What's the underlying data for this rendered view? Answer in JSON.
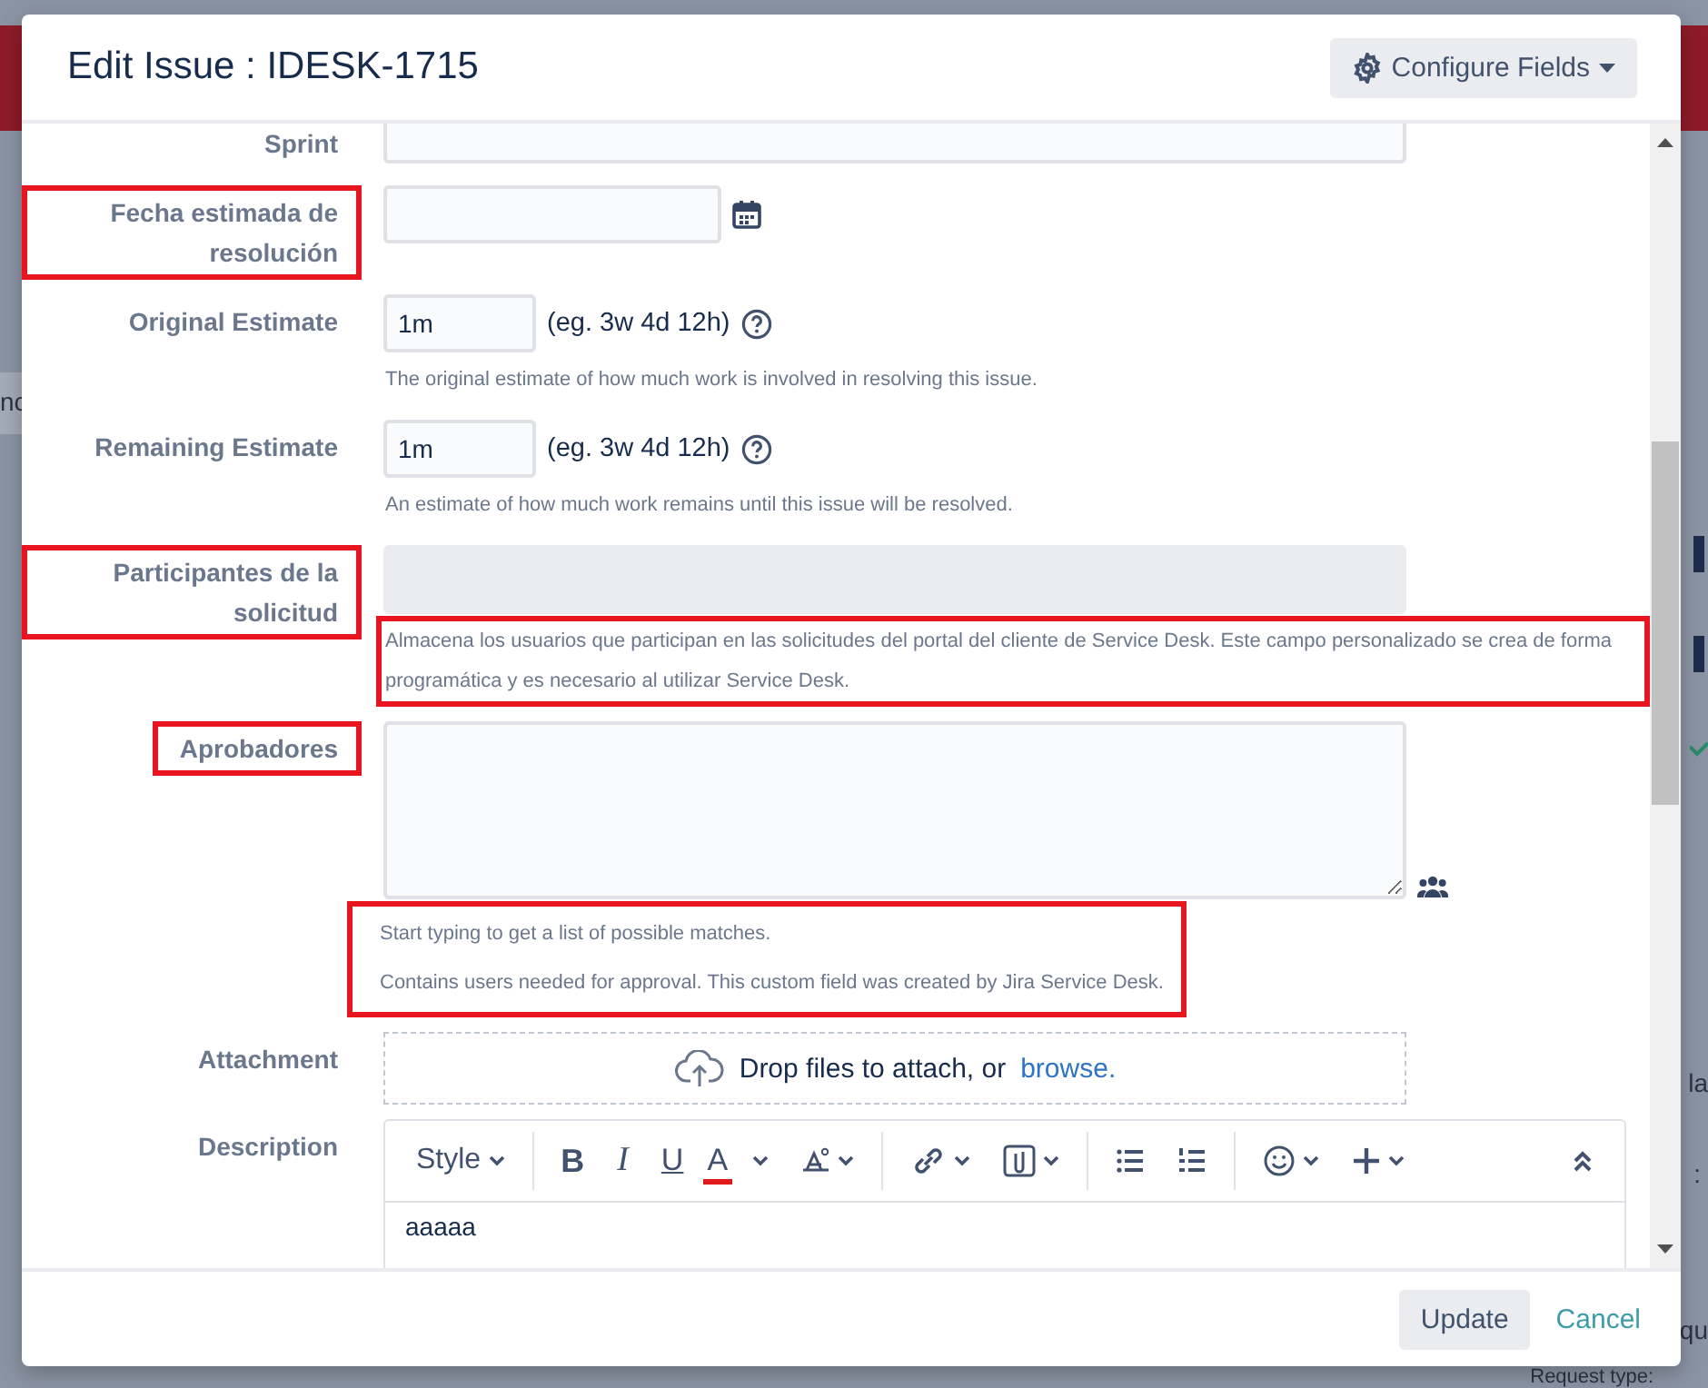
{
  "background_fragments": [
    "nc",
    "la",
    ":",
    "qu",
    "Request type:"
  ],
  "dialog": {
    "title": "Edit Issue : IDESK-1715",
    "configure_button": "Configure Fields"
  },
  "fields": [
    {
      "kind": "text",
      "label": "Sprint",
      "label_highlighted": false
    },
    {
      "kind": "date",
      "label": "Fecha estimada de resolución",
      "label_highlighted": true
    },
    {
      "kind": "estimate",
      "label": "Original Estimate",
      "label_highlighted": false,
      "value": "1m",
      "hint": "(eg. 3w 4d 12h)",
      "help": [
        "The original estimate of how much work is involved in resolving this issue."
      ],
      "help_highlighted": false
    },
    {
      "kind": "estimate",
      "label": "Remaining Estimate",
      "label_highlighted": false,
      "value": "1m",
      "hint": "(eg. 3w 4d 12h)",
      "help": [
        "An estimate of how much work remains until this issue will be resolved."
      ],
      "help_highlighted": false
    },
    {
      "kind": "participants",
      "label": "Participantes de la solicitud",
      "label_highlighted": true,
      "disabled": true,
      "help": [
        "Almacena los usuarios que participan en las solicitudes del portal del cliente de Service Desk. Este campo personalizado se crea de forma programática y es necesario al utilizar Service Desk."
      ],
      "help_highlighted": true
    },
    {
      "kind": "users",
      "label": "Aprobadores",
      "label_highlighted": true,
      "help": [
        "Start typing to get a list of possible matches.",
        "Contains users needed for approval. This custom field was created by Jira Service Desk."
      ],
      "help_highlighted": true
    },
    {
      "kind": "attachment",
      "label": "Attachment",
      "label_highlighted": false,
      "text": "Drop files to attach, or",
      "link": "browse."
    },
    {
      "kind": "editor",
      "label": "Description",
      "label_highlighted": false,
      "content": "aaaaa",
      "toolbar": [
        {
          "kind": "style",
          "text": "Style"
        },
        {
          "kind": "separator"
        },
        {
          "kind": "bold",
          "text": "B"
        },
        {
          "kind": "italic",
          "text": "I"
        },
        {
          "kind": "underline",
          "text": "U"
        },
        {
          "kind": "color",
          "text": "A"
        },
        {
          "kind": "more-format"
        },
        {
          "kind": "separator"
        },
        {
          "kind": "link"
        },
        {
          "kind": "attach"
        },
        {
          "kind": "separator"
        },
        {
          "kind": "bullet-list"
        },
        {
          "kind": "numbered-list"
        },
        {
          "kind": "separator"
        },
        {
          "kind": "emoji"
        },
        {
          "kind": "insert"
        },
        {
          "kind": "collapse"
        }
      ]
    }
  ],
  "footer": {
    "update_button": "Update",
    "cancel_link": "Cancel"
  }
}
